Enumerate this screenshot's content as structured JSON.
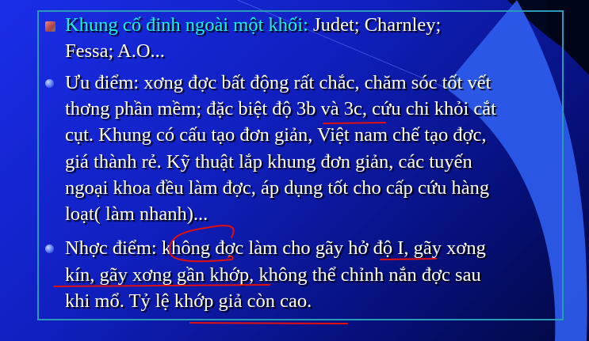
{
  "slide": {
    "item1": {
      "heading": "Khung cố đinh ngoài một khối:",
      "rest": " Judet; Charnley;",
      "line2": "Fessa; A.O..."
    },
    "item2": {
      "lines": [
        " Ưu điểm: xơng đợc bất động rất chắc, chăm sóc tốt vết",
        "thơng phần mềm; đặc biệt độ 3b và 3c, cứu chi khỏi cắt",
        "cụt. Khung có cấu tạo đơn giản, Việt nam chế tạo đợc,",
        "giá thành rẻ. Kỹ thuật lắp khung đơn giản, các tuyến",
        "ngoại khoa đều làm đợc, áp dụng tốt cho cấp cứu hàng",
        "loạt( làm nhanh)..."
      ]
    },
    "item3": {
      "lines": [
        "Nhợc điểm: không đợc làm cho gãy hở độ I, gãy xơng",
        "kín, gãy xơng gần khớp, không thể chỉnh nắn đợc sau",
        "khi mổ. Tỷ lệ khớp giả còn cao."
      ]
    }
  },
  "colors": {
    "heading": "#19f0e8",
    "annotation": "#e01010"
  }
}
